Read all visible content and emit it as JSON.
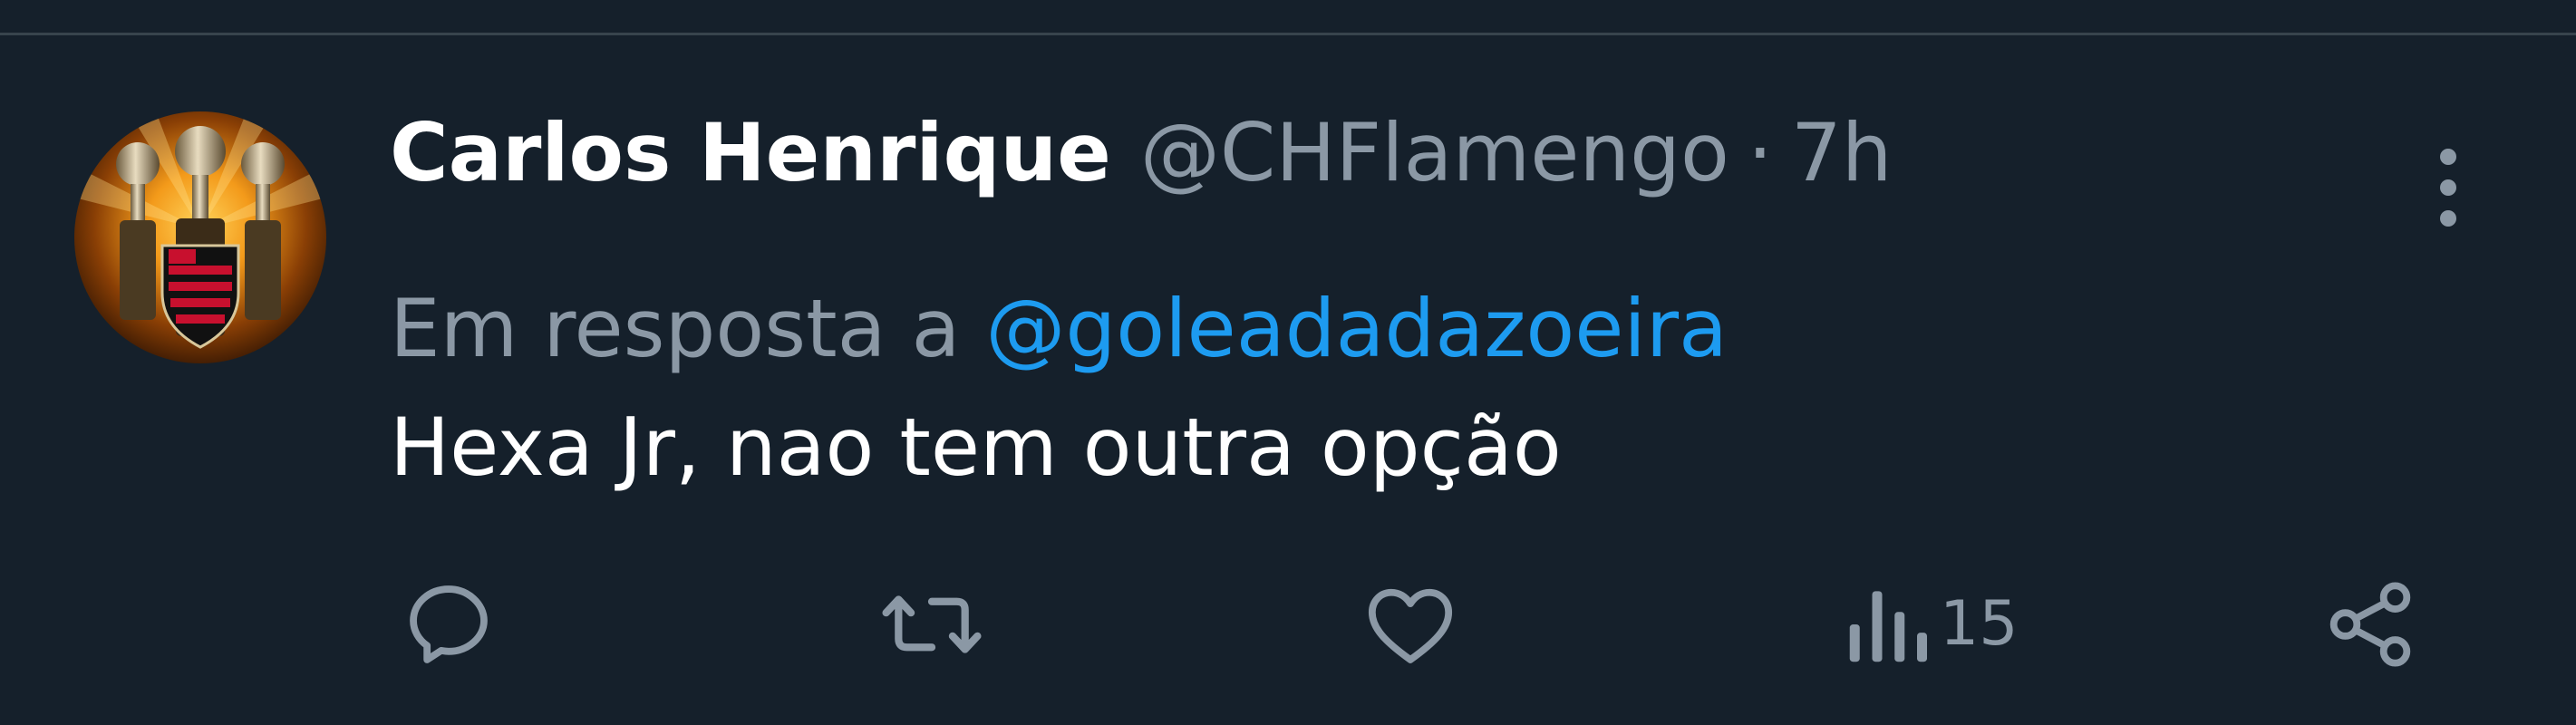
{
  "tweet": {
    "author": {
      "display_name": "Carlos Henrique",
      "handle": "@CHFlamengo"
    },
    "separator": "·",
    "timestamp": "7h",
    "reply_prefix": "Em resposta a",
    "reply_to": "@goleadadazoeira",
    "text": "Hexa Jr, nao tem outra opção",
    "actions": {
      "reply": {
        "icon": "reply-icon"
      },
      "retweet": {
        "icon": "retweet-icon"
      },
      "like": {
        "icon": "heart-icon"
      },
      "views": {
        "icon": "views-chart-icon",
        "count": "15"
      },
      "share": {
        "icon": "share-icon"
      }
    },
    "more": {
      "icon": "more-vertical-icon"
    }
  },
  "colors": {
    "background": "#15202b",
    "divider": "#38444d",
    "primary_text": "#ffffff",
    "secondary_text": "#8b98a5",
    "link": "#1d9bf0"
  }
}
